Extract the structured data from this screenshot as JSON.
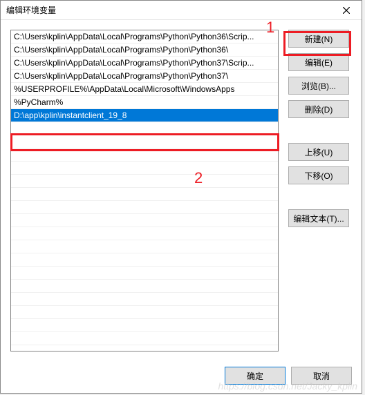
{
  "title": "编辑环境变量",
  "list_items": [
    "C:\\Users\\kplin\\AppData\\Local\\Programs\\Python\\Python36\\Scrip...",
    "C:\\Users\\kplin\\AppData\\Local\\Programs\\Python\\Python36\\",
    "C:\\Users\\kplin\\AppData\\Local\\Programs\\Python\\Python37\\Scrip...",
    "C:\\Users\\kplin\\AppData\\Local\\Programs\\Python\\Python37\\",
    "%USERPROFILE%\\AppData\\Local\\Microsoft\\WindowsApps",
    "%PyCharm%",
    "D:\\app\\kplin\\instantclient_19_8"
  ],
  "selected_index": 6,
  "buttons": {
    "new": "新建(N)",
    "edit": "编辑(E)",
    "browse": "浏览(B)...",
    "delete": "删除(D)",
    "moveup": "上移(U)",
    "movedown": "下移(O)",
    "edittext": "编辑文本(T)..."
  },
  "bottom": {
    "ok": "确定",
    "cancel": "取消"
  },
  "annotations": {
    "label1": "1",
    "label2": "2"
  },
  "watermark": "https://blog.csdn.net/Jacky_kplin"
}
